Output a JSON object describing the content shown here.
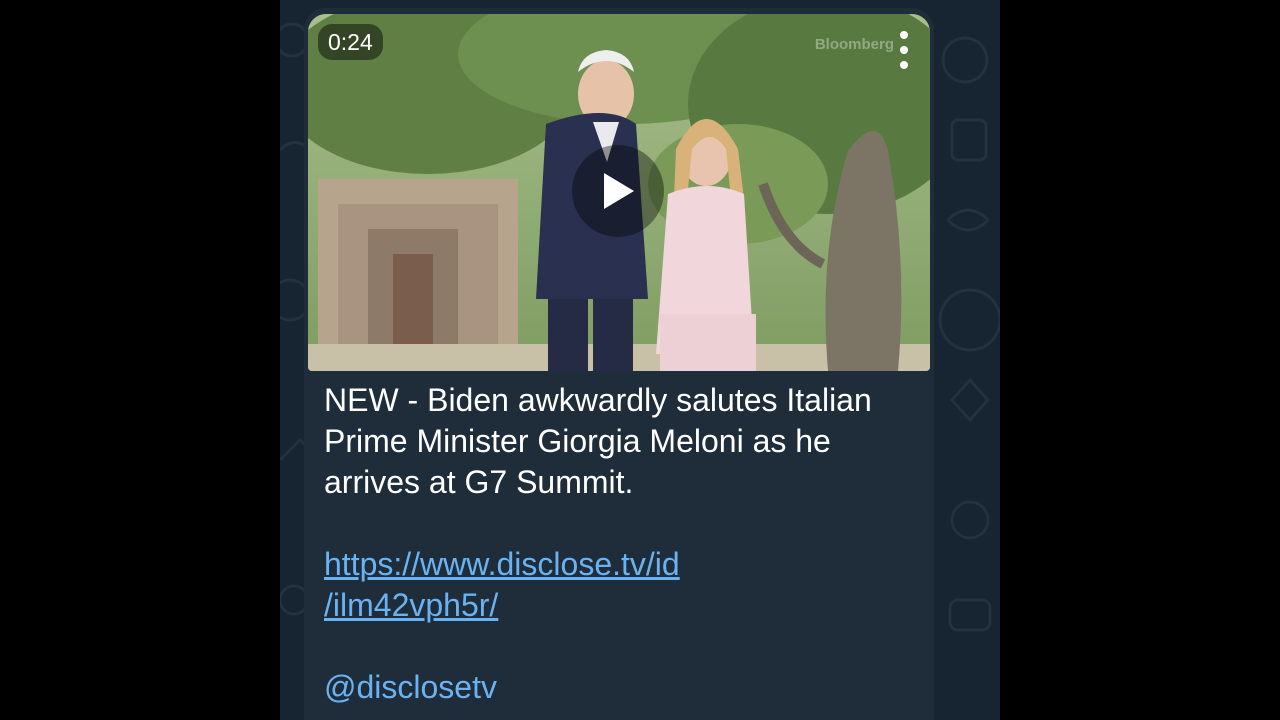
{
  "message": {
    "video": {
      "duration": "0:24",
      "watermark": "Bloomberg",
      "thumbnail_description_icon": "play-icon",
      "menu_icon": "more-vertical-icon"
    },
    "text": "NEW - Biden awkwardly salutes Italian Prime Minister Giorgia Meloni as he arrives at G7 Summit.",
    "link_line1": "https://www.disclose.tv/id",
    "link_line2": "/ilm42vph5r/",
    "mention": "@disclosetv"
  },
  "colors": {
    "chat_background": "#172431",
    "bubble": "#1f2c3a",
    "link": "#6ab3f3",
    "text": "#ffffff"
  }
}
